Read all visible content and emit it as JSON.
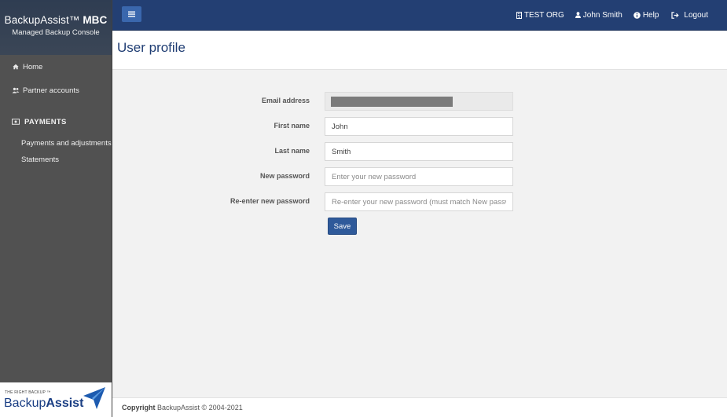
{
  "brand": {
    "title": "BackupAssist™",
    "title_bold": "MBC",
    "subtitle": "Managed Backup Console"
  },
  "sidebar": {
    "items": [
      {
        "label": "Home",
        "icon": "home-icon"
      },
      {
        "label": "Partner accounts",
        "icon": "users-icon"
      }
    ],
    "payments": {
      "heading": "PAYMENTS",
      "icon": "money-icon",
      "items": [
        {
          "label": "Payments and adjustments"
        },
        {
          "label": "Statements"
        }
      ]
    },
    "logo": {
      "tagline": "THE RIGHT BACKUP ™",
      "word_light": "Backup",
      "word_bold": "Assist"
    }
  },
  "topbar": {
    "org": "TEST ORG",
    "user": "John Smith",
    "help": "Help",
    "logout": "Logout"
  },
  "page": {
    "title": "User profile"
  },
  "form": {
    "email": {
      "label": "Email address",
      "value": ""
    },
    "first_name": {
      "label": "First name",
      "value": "John"
    },
    "last_name": {
      "label": "Last name",
      "value": "Smith"
    },
    "new_password": {
      "label": "New password",
      "placeholder": "Enter your new password"
    },
    "reenter_password": {
      "label": "Re-enter new password",
      "placeholder": "Re-enter your new password (must match New password)"
    },
    "save_label": "Save"
  },
  "footer": {
    "copyright_label": "Copyright",
    "text": "BackupAssist © 2004-2021"
  },
  "colors": {
    "topbar": "#233f73",
    "sidebar": "#515151",
    "accent": "#2f5a9a",
    "title": "#1f3d73"
  }
}
